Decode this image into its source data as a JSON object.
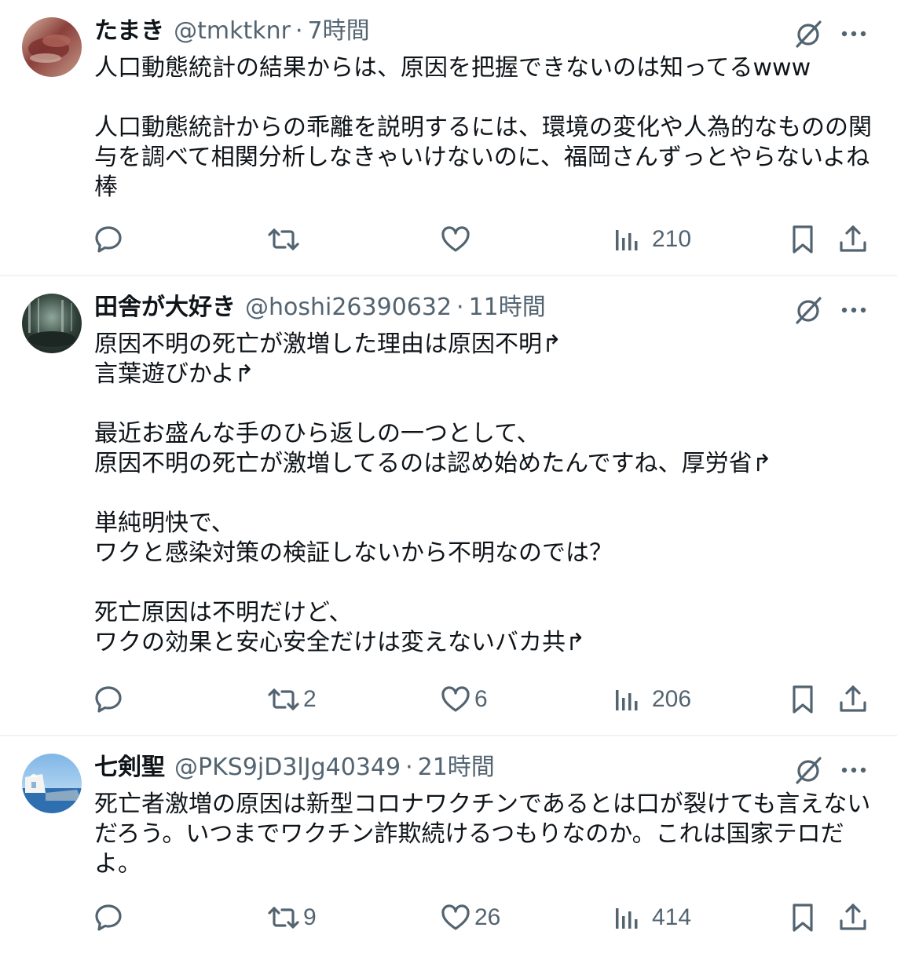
{
  "posts": [
    {
      "display_name": "たまき",
      "handle": "@tmktknr",
      "separator": "·",
      "time": "7時間",
      "text": "人口動態統計の結果からは、原因を把握できないのは知ってるwww\n\n人口動態統計からの乖離を説明するには、環境の変化や人為的なものの関与を調べて相関分析しなきゃいけないのに、福岡さんずっとやらないよね棒",
      "replies": "",
      "reposts": "",
      "likes": "",
      "views": "210"
    },
    {
      "display_name": "田舎が大好き",
      "handle": "@hoshi26390632",
      "separator": "·",
      "time": "11時間",
      "text": "原因不明の死亡が激増した理由は原因不明↱\n言葉遊びかよ↱\n\n最近お盛んな手のひら返しの一つとして、\n原因不明の死亡が激増してるのは認め始めたんですね、厚労省↱\n\n単純明快で、\nワクと感染対策の検証しないから不明なのでは？\n\n死亡原因は不明だけど、\nワクの効果と安心安全だけは変えないバカ共↱",
      "replies": "",
      "reposts": "2",
      "likes": "6",
      "views": "206"
    },
    {
      "display_name": "七剣聖",
      "handle": "@PKS9jD3lJg40349",
      "separator": "·",
      "time": "21時間",
      "text": "死亡者激増の原因は新型コロナワクチンであるとは口が裂けても言えないだろう。いつまでワクチン詐欺続けるつもりなのか。これは国家テロだよ。",
      "replies": "",
      "reposts": "9",
      "likes": "26",
      "views": "414"
    }
  ],
  "icons": {
    "reply": "reply-icon",
    "repost": "repost-icon",
    "like": "like-icon",
    "views": "views-icon",
    "bookmark": "bookmark-icon",
    "share": "share-icon",
    "grok": "grok-icon",
    "more": "more-icon"
  },
  "colors": {
    "text": "#0f1419",
    "secondary": "#536471",
    "divider": "#eff3f4"
  }
}
